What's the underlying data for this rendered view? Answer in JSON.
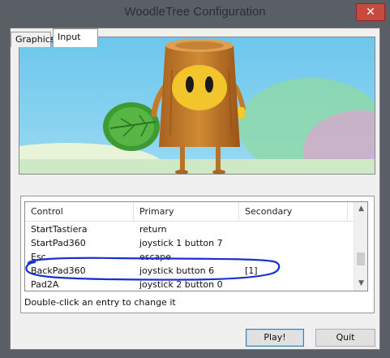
{
  "window": {
    "title": "WoodleTree Configuration",
    "close_glyph": "✕",
    "accent_color": "#c74a3e"
  },
  "tabs": [
    {
      "label": "Graphics",
      "selected": false
    },
    {
      "label": "Input",
      "selected": true
    }
  ],
  "input_table": {
    "headers": [
      "Control",
      "Primary",
      "Secondary"
    ],
    "rows": [
      [
        "StartTastiera",
        "return",
        ""
      ],
      [
        "StartPad360",
        "joystick 1 button 7",
        ""
      ],
      [
        "Esc",
        "escape",
        ""
      ],
      [
        "BackPad360",
        "joystick button 6",
        "[1]"
      ],
      [
        "Pad2A",
        "joystick 2 button 0",
        ""
      ]
    ],
    "annotation_color": "#1a2fd0"
  },
  "hint": "Double-click an entry to change it",
  "buttons": {
    "play": "Play!",
    "quit": "Quit"
  }
}
